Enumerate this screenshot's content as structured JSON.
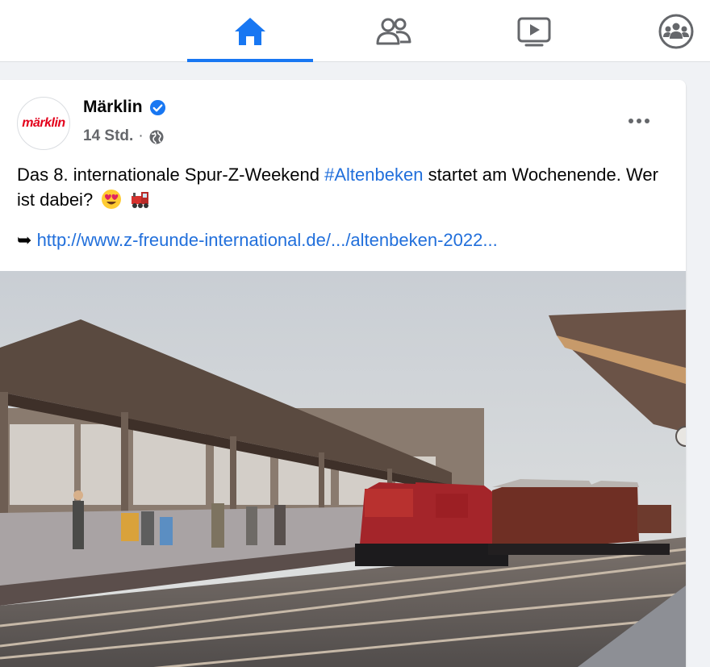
{
  "nav": {
    "tabs": [
      {
        "name": "home",
        "icon": "home-icon",
        "active": true
      },
      {
        "name": "friends",
        "icon": "friends-icon",
        "active": false
      },
      {
        "name": "watch",
        "icon": "video-icon",
        "active": false
      },
      {
        "name": "groups",
        "icon": "groups-icon",
        "active": false
      }
    ],
    "active_color": "#1877f2",
    "icon_color": "#65676b"
  },
  "post": {
    "author": "Märklin",
    "avatar_logo_text": "märklin",
    "verified": true,
    "time": "14 Std.",
    "separator": "·",
    "audience_icon": "globe-icon",
    "text_before": "Das 8. internationale Spur-Z-Weekend ",
    "hashtag": "#Altenbeken",
    "text_after": " startet am Wochenende. Wer ist dabei?",
    "emojis": [
      "heart-eyes-emoji",
      "locomotive-emoji"
    ],
    "link_arrow": "➥",
    "link": "http://www.z-freunde-international.de/.../altenbeken-2022...",
    "image_description_icon": "photo-image",
    "link_color": "#216fdb"
  }
}
